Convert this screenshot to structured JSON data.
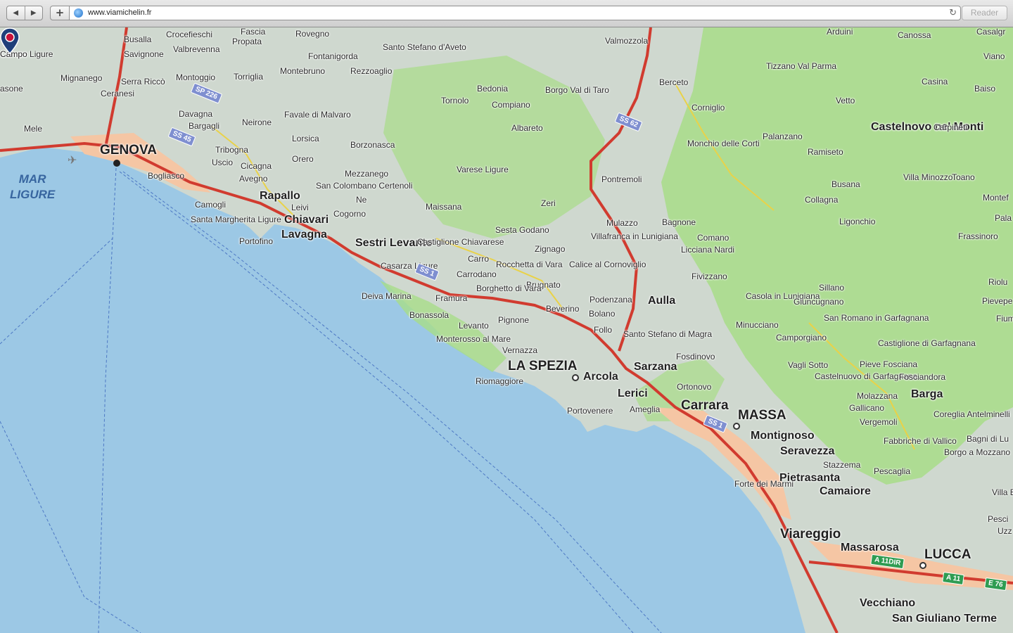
{
  "browser": {
    "url": "www.viamichelin.fr",
    "reader_label": "Reader",
    "back_glyph": "◀",
    "forward_glyph": "▶",
    "add_glyph": "+",
    "reload_glyph": "↻"
  },
  "map": {
    "sea_label": [
      "MAR",
      "LIGURE"
    ],
    "places": [
      "Busalla",
      "Crocefieschi",
      "Fascia",
      "Propata",
      "Rovegno",
      "Savignone",
      "Valbrevenna",
      "Campo Ligure",
      "Mignanego",
      "Serra Riccò",
      "Montoggio",
      "Torriglia",
      "Montebruno",
      "Fontanigorda",
      "Santo Stefano d'Aveto",
      "Rezzoaglio",
      "Valmozzola",
      "Casalgr",
      "Ceranesi",
      "Davagna",
      "Bargagli",
      "Neirone",
      "Favale di Malvaro",
      "Lorsica",
      "Bedonia",
      "Borgo Val di Taro",
      "Tornolo",
      "Compiano",
      "Berceto",
      "Corniglio",
      "Albareto",
      "Mele",
      "GENOVA",
      "Tribogna",
      "Uscio",
      "Cicagna",
      "Orero",
      "Borzonasca",
      "Mezzanego",
      "Varese Ligure",
      "Bogliasco",
      "Avegno",
      "San Colombano Certenoli",
      "Pontremoli",
      "Camogli",
      "Rapallo",
      "Leivi",
      "Ne",
      "Maissana",
      "Zeri",
      "Santa Margherita Ligure",
      "Chiavari",
      "Cogorno",
      "Lavagna",
      "Portofino",
      "Sestri Levante",
      "Castiglione Chiavarese",
      "Sesta Godano",
      "Zignago",
      "Mulazzo",
      "Bagnone",
      "Villafranca in Lunigiana",
      "Comano",
      "Licciana Nardi",
      "Casarza Ligure",
      "Carro",
      "Carrodano",
      "Rocchetta di Vara",
      "Calice al Cornoviglio",
      "Brugnato",
      "Borghetto di Vara",
      "Deiva Marina",
      "Framura",
      "Bonassola",
      "Levanto",
      "Pignone",
      "Monterosso al Mare",
      "Vernazza",
      "Beverino",
      "Bolano",
      "Podenzana",
      "Aulla",
      "Follo",
      "Santo Stefano di Magra",
      "Fivizzano",
      "Fosdinovo",
      "LA SPEZIA",
      "Arcola",
      "Sarzana",
      "Riomaggiore",
      "Lerici",
      "Ameglia",
      "Portovenere",
      "Ortonovo",
      "Carrara",
      "MASSA",
      "Montignoso",
      "Seravezza",
      "Stazzema",
      "Pietrasanta",
      "Camaiore",
      "Forte dei Marmi",
      "Viareggio",
      "Massarosa",
      "LUCCA",
      "Vecchiano",
      "San Giuliano Terme",
      "Arduini",
      "Canossa",
      "Viano",
      "Tizzano Val Parma",
      "Casina",
      "Baiso",
      "Vetto",
      "Castelnovo ne' Monti",
      "Carpineti",
      "Monchio delle Corti",
      "Palanzano",
      "Ramiseto",
      "Villa Minozzo",
      "Toano",
      "Busana",
      "Collagna",
      "Ligonchio",
      "Frassinoro",
      "Sillano",
      "Casola in Lunigiana",
      "Giuncugnano",
      "Minucciano",
      "San Romano in Garfagnana",
      "Camporgiano",
      "Castiglione di Garfagnana",
      "Pieve Fosciana",
      "Vagli Sotto",
      "Castelnuovo di Garfagnana",
      "Fosciandora",
      "Molazzana",
      "Barga",
      "Gallicano",
      "Vergemoli",
      "Coreglia Antelminelli",
      "Fabbriche di Vallico",
      "Bagni di Lu",
      "Borgo a Mozzano",
      "Pescaglia",
      "Villa Basilic",
      "Pesci",
      "Montef",
      "Pala",
      "Riolu",
      "Pievepe",
      "Fium",
      "Uzz",
      "asone",
      "Campo"
    ],
    "road_shields": [
      "SP 226",
      "SS 45",
      "SS 62",
      "SS 1",
      "SS 1",
      "A 11DIR",
      "A 11",
      "E 76"
    ]
  }
}
